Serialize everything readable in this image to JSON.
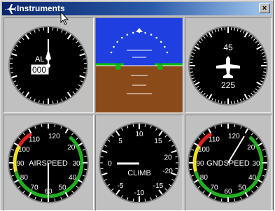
{
  "window": {
    "title": "Instruments",
    "close_label": "×",
    "icon": "airplane-icon"
  },
  "altimeter": {
    "label": "AL",
    "digits": "000"
  },
  "heading": {
    "top_label": "45",
    "bottom_label": "225",
    "icon": "airplane-icon"
  },
  "airspeed": {
    "label": "AIRSPEED",
    "ticks": [
      "110",
      "120",
      "100",
      "90",
      "80",
      "70",
      "60",
      "50",
      "40",
      "30",
      "20"
    ]
  },
  "climb": {
    "label": "CLIMB",
    "ticks": [
      "10",
      "15",
      "5",
      "0",
      "-5",
      "-10",
      "-15",
      "-20",
      "20"
    ]
  },
  "groundspeed": {
    "label": "GNDSPEED",
    "ticks": [
      "110",
      "120",
      "100",
      "90",
      "80",
      "70",
      "60",
      "50",
      "40",
      "30",
      "20"
    ]
  },
  "colors": {
    "sky": "#1f3fe0",
    "ground": "#8b4a1a",
    "horizon_marker": "#00c000",
    "titlebar": "#0a246a",
    "warning_band": "#e02020",
    "caution_band": "#f0e020",
    "normal_band": "#20b020"
  }
}
